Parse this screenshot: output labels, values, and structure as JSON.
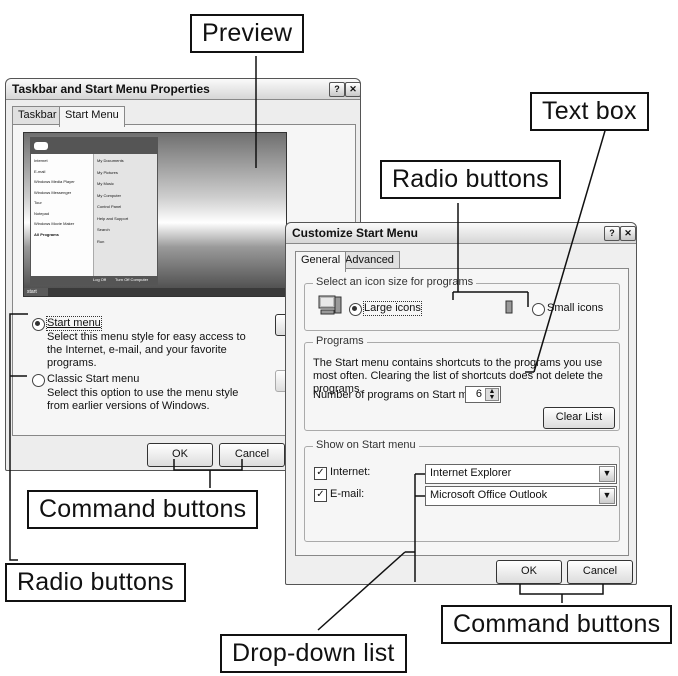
{
  "background_color": "#ffffff",
  "callouts": {
    "preview": "Preview",
    "text_box": "Text box",
    "radio_buttons_top": "Radio buttons",
    "command_buttons_left": "Command buttons",
    "radio_buttons_left": "Radio buttons",
    "drop_down_list": "Drop-down list",
    "command_buttons_right": "Command buttons"
  },
  "taskbar_dialog": {
    "title": "Taskbar and Start Menu Properties",
    "help_icon": "?",
    "close_icon": "✕",
    "tabs": [
      "Taskbar",
      "Start Menu"
    ],
    "preview": {
      "left_items": [
        "Internet",
        "E-mail",
        "Windows Media Player",
        "Windows Messenger",
        "Tour",
        "Notepad",
        "Windows Movie Maker"
      ],
      "right_items": [
        "My Documents",
        "My Pictures",
        "My Music",
        "My Computer",
        "Control Panel",
        "Help and Support",
        "Search",
        "Run"
      ],
      "all_programs": "All Programs",
      "log_off": "Log Off",
      "turn_off": "Turn Off Computer",
      "start": "start"
    },
    "options": [
      {
        "label": "Start menu",
        "desc": "Select this menu style for easy access to the Internet, e-mail, and your favorite programs.",
        "selected": true
      },
      {
        "label": "Classic Start menu",
        "desc": "Select this option to use the menu style from earlier versions of Windows.",
        "selected": false
      }
    ],
    "ok": "OK",
    "cancel": "Cancel"
  },
  "customize_dialog": {
    "title": "Customize Start Menu",
    "help_icon": "?",
    "close_icon": "✕",
    "tabs": [
      "General",
      "Advanced"
    ],
    "icon_size_group": "Select an icon size for programs",
    "large_icons": "Large icons",
    "small_icons": "Small icons",
    "programs_group": "Programs",
    "programs_text": "The Start menu contains shortcuts to the programs you use most often. Clearing the list of shortcuts does not delete the programs.",
    "number_label": "Number of programs on Start menu:",
    "number_value": "6",
    "clear_list": "Clear List",
    "show_group": "Show on Start menu",
    "internet_label": "Internet:",
    "internet_value": "Internet Explorer",
    "email_label": "E-mail:",
    "email_value": "Microsoft Office Outlook",
    "ok": "OK",
    "cancel": "Cancel"
  }
}
